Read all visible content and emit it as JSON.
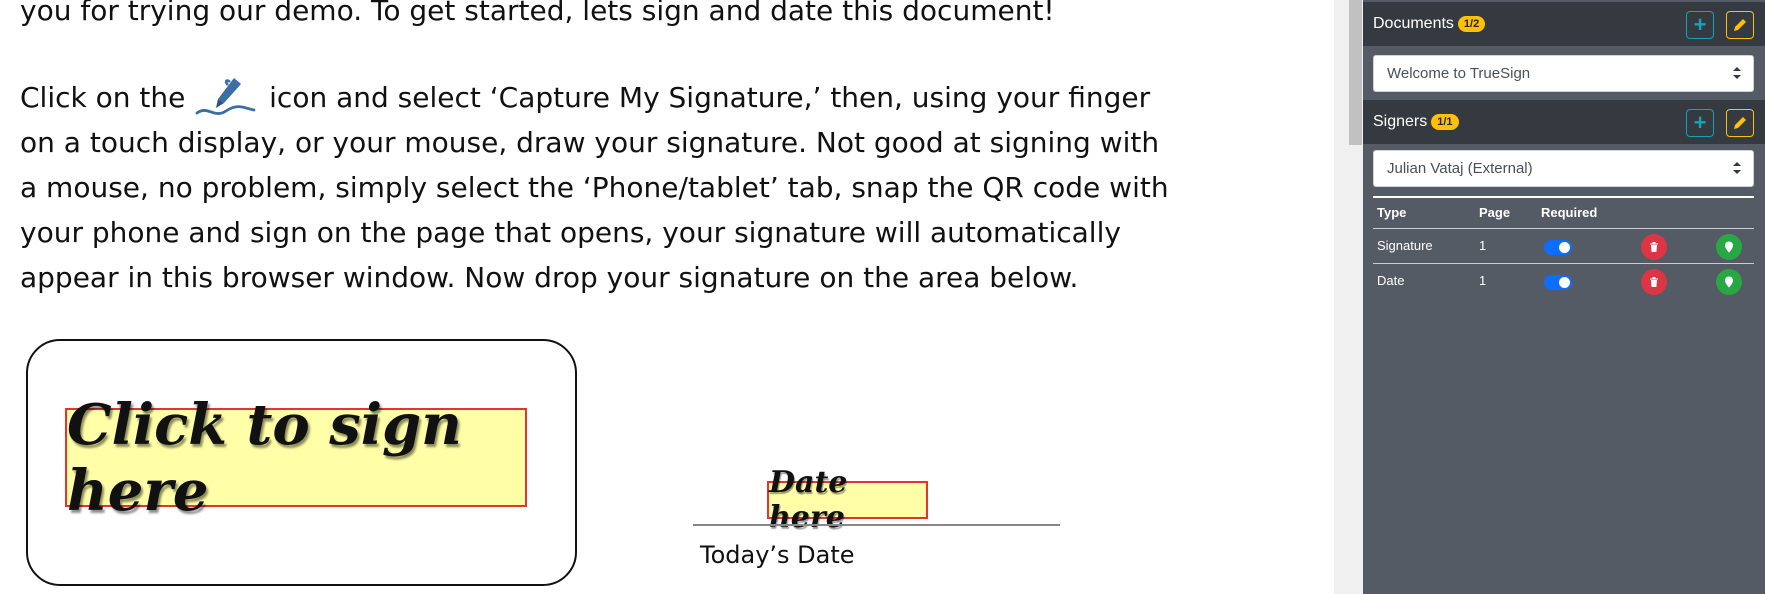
{
  "document": {
    "line_top": "you for trying our demo.  To get started, lets sign and date this document!",
    "para_line1_before": "Click on the ",
    "para_line1_after": " icon and select ‘Capture My Signature,’ then, using your finger",
    "para_line2": "on a touch display, or your mouse, draw your signature.  Not good at signing with",
    "para_line3": "a mouse, no problem, simply select the ‘Phone/tablet’ tab, snap the QR code with",
    "para_line4": "your phone and sign on the page that opens, your signature will automatically",
    "para_line5": "appear in this browser window.  Now drop your signature on the area below.",
    "pen_icon": "pen-signature-icon",
    "signature_field": "Click to sign here",
    "date_field": "Date here",
    "date_label": "Today’s Date"
  },
  "panel": {
    "documents": {
      "title": "Documents",
      "badge": "1/2",
      "selected": "Welcome to TrueSign"
    },
    "signers": {
      "title": "Signers",
      "badge": "1/1",
      "selected": "Julian Vataj (External)"
    },
    "fields": {
      "headers": {
        "type": "Type",
        "page": "Page",
        "required": "Required"
      },
      "rows": [
        {
          "type": "Signature",
          "page": "1",
          "required": true
        },
        {
          "type": "Date",
          "page": "1",
          "required": true
        }
      ]
    }
  },
  "colors": {
    "panel_bg": "#555b64",
    "header_bg": "#343a40",
    "badge": "#ffc107",
    "add_btn": "#17a2b8",
    "edit_btn": "#ffc107",
    "delete_btn": "#dc3545",
    "locate_btn": "#28a745",
    "toggle_on": "#0d6efd",
    "field_fill": "#ffffa8",
    "field_border": "#e53333"
  }
}
